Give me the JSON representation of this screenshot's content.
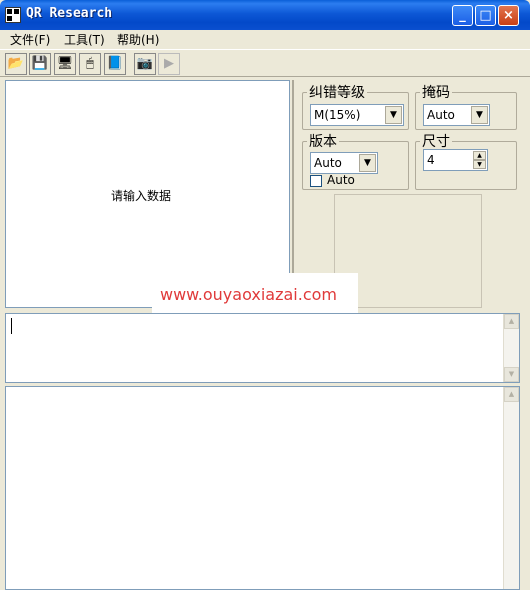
{
  "window": {
    "title": "QR Research",
    "controls": {
      "minimize": "_",
      "maximize": "□",
      "close": "×"
    }
  },
  "menu": [
    {
      "label": "文件(F)"
    },
    {
      "label": "工具(T)"
    },
    {
      "label": "帮助(H)"
    }
  ],
  "toolbar": {
    "buttons": [
      {
        "icon": "open-folder-icon",
        "glyph": "📂"
      },
      {
        "icon": "save-icon",
        "glyph": "💾"
      },
      {
        "icon": "monitor-icon",
        "glyph": "🖥"
      },
      {
        "icon": "mouse-icon",
        "glyph": "🖱"
      },
      {
        "icon": "book-icon",
        "glyph": "📘"
      },
      {
        "icon": "camera-icon",
        "glyph": "📷"
      },
      {
        "icon": "play-icon",
        "glyph": "▶"
      }
    ]
  },
  "input_pane": {
    "prompt": "请输入数据"
  },
  "settings": {
    "error_level": {
      "label": "纠错等级",
      "value": "M(15%)"
    },
    "mask": {
      "label": "掩码",
      "value": "Auto"
    },
    "version": {
      "label": "版本",
      "value": "Auto",
      "checkbox_label": "Auto",
      "checked": false
    },
    "size": {
      "label": "尺寸",
      "value": "4"
    }
  },
  "watermark": {
    "text": "www.ouyaoxiazai.com"
  },
  "text_input": {
    "value": ""
  },
  "output": {
    "value": ""
  },
  "colors": {
    "titlebar": "#0a5fd8",
    "watermark": "#e03a3a",
    "border": "#7f9db9",
    "face": "#ece9d8"
  }
}
